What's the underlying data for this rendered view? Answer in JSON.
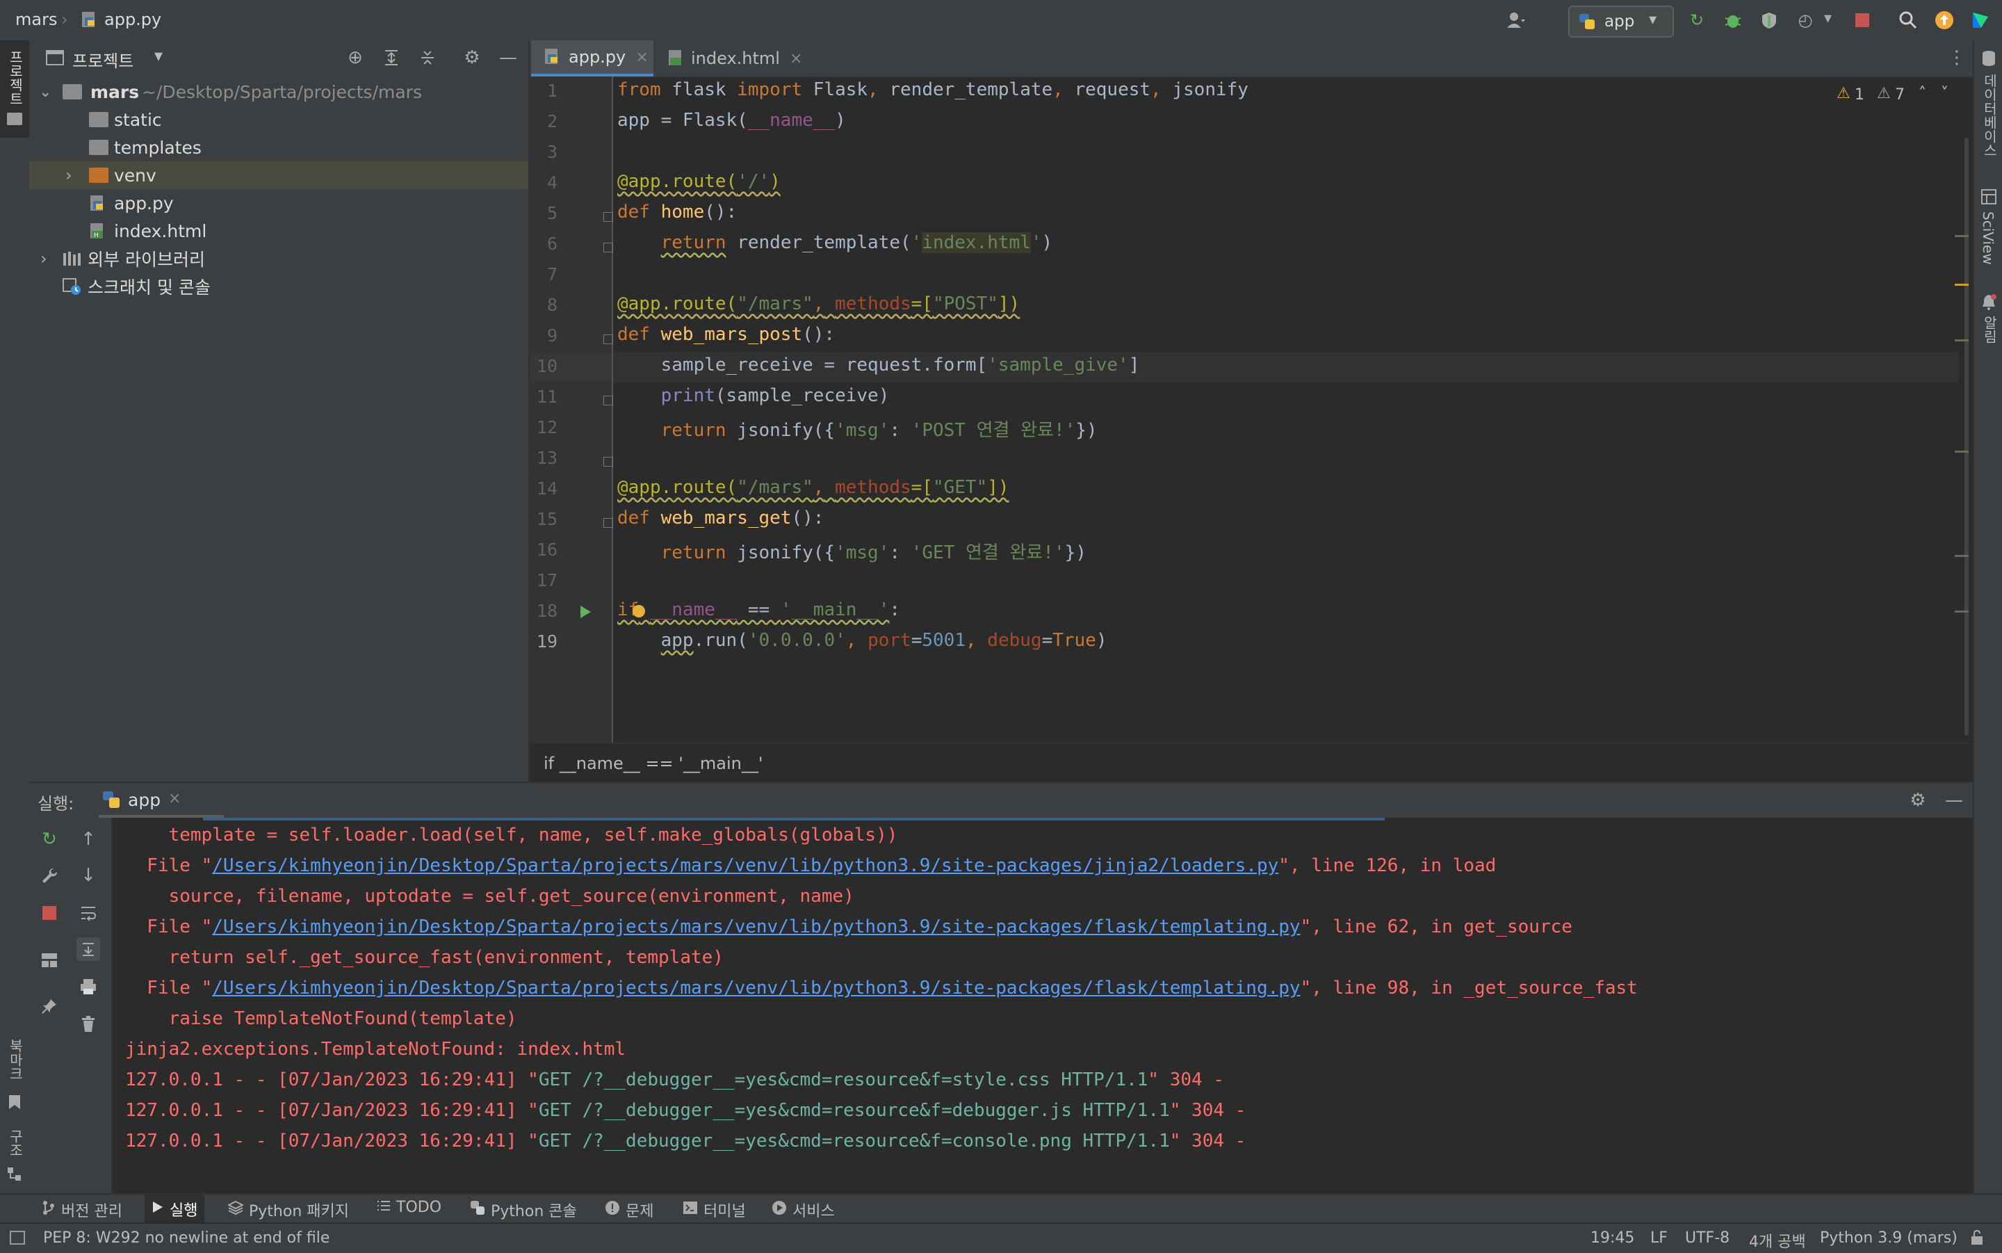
{
  "title_bar": {
    "project": "mars",
    "file": "app.py",
    "run_config": "app"
  },
  "left_stripe": {
    "project_tab": "프로젝트",
    "bookmarks_tab": "북마크",
    "structure_tab": "구조"
  },
  "right_stripe": {
    "database_tab": "데이터베이스",
    "sciview_tab": "SciView",
    "notifications_tab": "알림"
  },
  "project_panel": {
    "title": "프로젝트",
    "tree": [
      {
        "label": "mars",
        "path": "~/Desktop/Sparta/projects/mars"
      },
      {
        "label": "static"
      },
      {
        "label": "templates"
      },
      {
        "label": "venv"
      },
      {
        "label": "app.py"
      },
      {
        "label": "index.html"
      },
      {
        "label": "외부 라이브러리"
      },
      {
        "label": "스크래치 및 콘솔"
      }
    ]
  },
  "editor": {
    "tabs": [
      {
        "label": "app.py",
        "active": true
      },
      {
        "label": "index.html",
        "active": false
      }
    ],
    "inspections": {
      "warnings": "1",
      "weak_warnings": "7"
    },
    "breadcrumb": "if __name__ == '__main__'",
    "line_numbers": [
      "1",
      "2",
      "3",
      "4",
      "5",
      "6",
      "7",
      "8",
      "9",
      "10",
      "11",
      "12",
      "13",
      "14",
      "15",
      "16",
      "17",
      "18",
      "19"
    ]
  },
  "run_panel": {
    "label": "실행:",
    "tab": "app",
    "output": [
      {
        "type": "plain",
        "text": "    template = self.loader.load(self, name, self.make_globals(globals))"
      },
      {
        "type": "file",
        "prefix": "  File \"",
        "link": "/Users/kimhyeonjin/Desktop/Sparta/projects/mars/venv/lib/python3.9/site-packages/jinja2/loaders.py",
        "suffix": "\", line 126, in load"
      },
      {
        "type": "plain",
        "text": "    source, filename, uptodate = self.get_source(environment, name)"
      },
      {
        "type": "file",
        "prefix": "  File \"",
        "link": "/Users/kimhyeonjin/Desktop/Sparta/projects/mars/venv/lib/python3.9/site-packages/flask/templating.py",
        "suffix": "\", line 62, in get_source"
      },
      {
        "type": "plain",
        "text": "    return self._get_source_fast(environment, template)"
      },
      {
        "type": "file",
        "prefix": "  File \"",
        "link": "/Users/kimhyeonjin/Desktop/Sparta/projects/mars/venv/lib/python3.9/site-packages/flask/templating.py",
        "suffix": "\", line 98, in _get_source_fast"
      },
      {
        "type": "plain",
        "text": "    raise TemplateNotFound(template)"
      },
      {
        "type": "plain",
        "text": "jinja2.exceptions.TemplateNotFound: index.html"
      },
      {
        "type": "log",
        "prefix": "127.0.0.1 - - [07/Jan/2023 16:29:41] \"",
        "req": "GET /?__debugger__=yes&cmd=resource&f=style.css HTTP/1.1",
        "suffix": "\" 304 -"
      },
      {
        "type": "log",
        "prefix": "127.0.0.1 - - [07/Jan/2023 16:29:41] \"",
        "req": "GET /?__debugger__=yes&cmd=resource&f=debugger.js HTTP/1.1",
        "suffix": "\" 304 -"
      },
      {
        "type": "log",
        "prefix": "127.0.0.1 - - [07/Jan/2023 16:29:41] \"",
        "req": "GET /?__debugger__=yes&cmd=resource&f=console.png HTTP/1.1",
        "suffix": "\" 304 -"
      }
    ]
  },
  "tool_windows": [
    {
      "label": "버전 관리",
      "icon": "branch-icon"
    },
    {
      "label": "실행",
      "icon": "run-icon"
    },
    {
      "label": "Python 패키지",
      "icon": "layers-icon"
    },
    {
      "label": "TODO",
      "icon": "list-icon"
    },
    {
      "label": "Python 콘솔",
      "icon": "python-icon"
    },
    {
      "label": "문제",
      "icon": "problem-icon"
    },
    {
      "label": "터미널",
      "icon": "terminal-icon"
    },
    {
      "label": "서비스",
      "icon": "services-icon"
    }
  ],
  "status_bar": {
    "message": "PEP 8: W292 no newline at end of file",
    "position": "19:45",
    "line_sep": "LF",
    "encoding": "UTF-8",
    "indent": "4개 공백",
    "interpreter": "Python 3.9 (mars)"
  },
  "colors": {
    "keyword": "#cc7832",
    "string": "#6a8759",
    "decorator": "#bbb529",
    "function": "#ffc66d",
    "error_output": "#ff6b68",
    "link": "#589df6"
  }
}
